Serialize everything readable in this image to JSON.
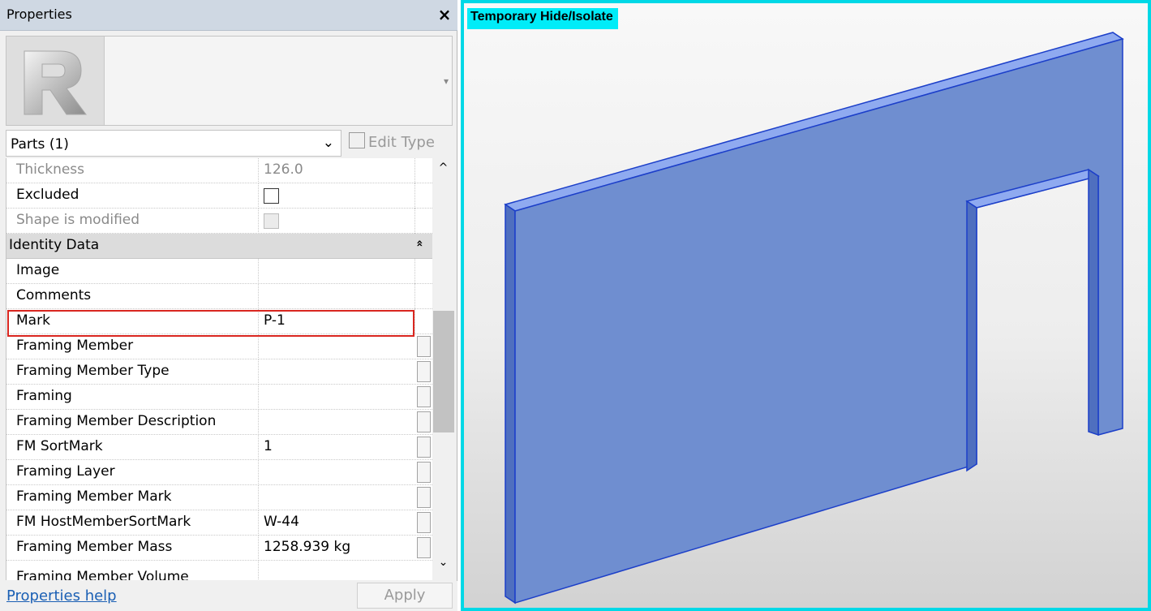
{
  "panel": {
    "title": "Properties",
    "close_glyph": "×",
    "type_arrow_glyph": "▾",
    "filter": {
      "value": "Parts (1)",
      "arrow_glyph": "⌄"
    },
    "edit_type_label": "Edit Type",
    "rows": [
      {
        "name": "Thickness",
        "value": "126.0"
      },
      {
        "name": "Excluded",
        "value": ""
      },
      {
        "name": "Shape is modified",
        "value": ""
      },
      {
        "name": "Identity Data",
        "value": ""
      },
      {
        "name": "Image",
        "value": ""
      },
      {
        "name": "Comments",
        "value": ""
      },
      {
        "name": "Mark",
        "value": "P-1"
      },
      {
        "name": "Framing Member",
        "value": ""
      },
      {
        "name": "Framing Member Type",
        "value": ""
      },
      {
        "name": "Framing",
        "value": ""
      },
      {
        "name": "Framing Member Description",
        "value": ""
      },
      {
        "name": "FM SortMark",
        "value": "1"
      },
      {
        "name": "Framing Layer",
        "value": ""
      },
      {
        "name": "Framing Member Mark",
        "value": ""
      },
      {
        "name": "FM HostMemberSortMark",
        "value": "W-44"
      },
      {
        "name": "Framing Member Mass",
        "value": "1258.939 kg"
      },
      {
        "name": "Framing Member Volume",
        "value": ""
      }
    ],
    "group_chevron_glyph": "»",
    "scroll_up_glyph": "^",
    "scroll_down_glyph": "⌄",
    "help_link": "Properties help",
    "apply_label": "Apply"
  },
  "viewport": {
    "label": "Temporary Hide/Isolate"
  },
  "colors": {
    "isolate_border": "#00d8e6",
    "wall_face": "#6f8ed0",
    "highlight": "#d9261f"
  }
}
